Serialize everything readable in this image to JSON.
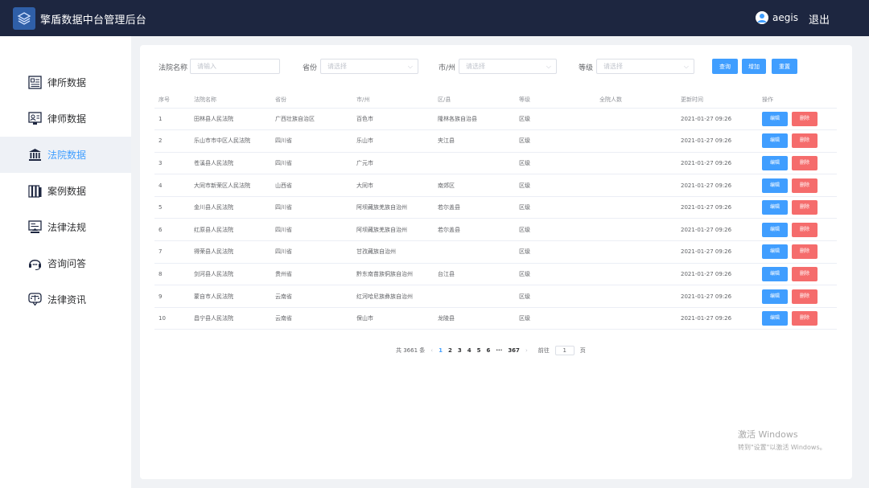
{
  "header": {
    "title": "擎盾数据中台管理后台",
    "username": "aegis",
    "logout": "退出"
  },
  "sidebar": {
    "items": [
      {
        "label": "律所数据",
        "icon": "law-firm-icon",
        "active": false
      },
      {
        "label": "律师数据",
        "icon": "lawyer-icon",
        "active": false
      },
      {
        "label": "法院数据",
        "icon": "court-icon",
        "active": true
      },
      {
        "label": "案例数据",
        "icon": "books-icon",
        "active": false
      },
      {
        "label": "法律法规",
        "icon": "regulation-icon",
        "active": false
      },
      {
        "label": "咨询问答",
        "icon": "headset-icon",
        "active": false
      },
      {
        "label": "法律资讯",
        "icon": "scales-icon",
        "active": false
      }
    ]
  },
  "filters": {
    "court_name_label": "法院名称",
    "court_name_placeholder": "请输入",
    "province_label": "省份",
    "province_placeholder": "请选择",
    "city_label": "市/州",
    "city_placeholder": "请选择",
    "level_label": "等级",
    "level_placeholder": "请选择",
    "query_button": "查询",
    "add_button": "增加",
    "reset_button": "重置"
  },
  "table": {
    "headers": [
      "序号",
      "法院名称",
      "省份",
      "市/州",
      "区/县",
      "等级",
      "全院人数",
      "更新时间",
      "操作"
    ],
    "edit_label": "编辑",
    "delete_label": "删除",
    "rows": [
      [
        "1",
        "田林县人民法院",
        "广西壮族自治区",
        "百色市",
        "隆林各族自治县",
        "区级",
        "",
        "2021-01-27 09:26"
      ],
      [
        "2",
        "乐山市市中区人民法院",
        "四川省",
        "乐山市",
        "夹江县",
        "区级",
        "",
        "2021-01-27 09:26"
      ],
      [
        "3",
        "苍溪县人民法院",
        "四川省",
        "广元市",
        "",
        "区级",
        "",
        "2021-01-27 09:26"
      ],
      [
        "4",
        "大同市新荣区人民法院",
        "山西省",
        "大同市",
        "南郊区",
        "区级",
        "",
        "2021-01-27 09:26"
      ],
      [
        "5",
        "金川县人民法院",
        "四川省",
        "阿坝藏族羌族自治州",
        "若尔盖县",
        "区级",
        "",
        "2021-01-27 09:26"
      ],
      [
        "6",
        "红原县人民法院",
        "四川省",
        "阿坝藏族羌族自治州",
        "若尔盖县",
        "区级",
        "",
        "2021-01-27 09:26"
      ],
      [
        "7",
        "得荣县人民法院",
        "四川省",
        "甘孜藏族自治州",
        "",
        "区级",
        "",
        "2021-01-27 09:26"
      ],
      [
        "8",
        "剑河县人民法院",
        "贵州省",
        "黔东南苗族侗族自治州",
        "台江县",
        "区级",
        "",
        "2021-01-27 09:26"
      ],
      [
        "9",
        "蒙自市人民法院",
        "云南省",
        "红河哈尼族彝族自治州",
        "",
        "区级",
        "",
        "2021-01-27 09:26"
      ],
      [
        "10",
        "昌宁县人民法院",
        "云南省",
        "保山市",
        "龙陵县",
        "区级",
        "",
        "2021-01-27 09:26"
      ]
    ]
  },
  "pagination": {
    "total_text": "共 3661 条",
    "pages": [
      "1",
      "2",
      "3",
      "4",
      "5",
      "6"
    ],
    "ellipsis": "···",
    "last_page": "367",
    "current_page": "1",
    "goto_prefix": "前往",
    "goto_value": "1",
    "goto_suffix": "页"
  },
  "watermark": {
    "line1": "激活 Windows",
    "line2": "转到\"设置\"以激活 Windows。"
  },
  "colors": {
    "header_bg": "#1d2640",
    "primary": "#409eff",
    "danger": "#f56c6c"
  }
}
